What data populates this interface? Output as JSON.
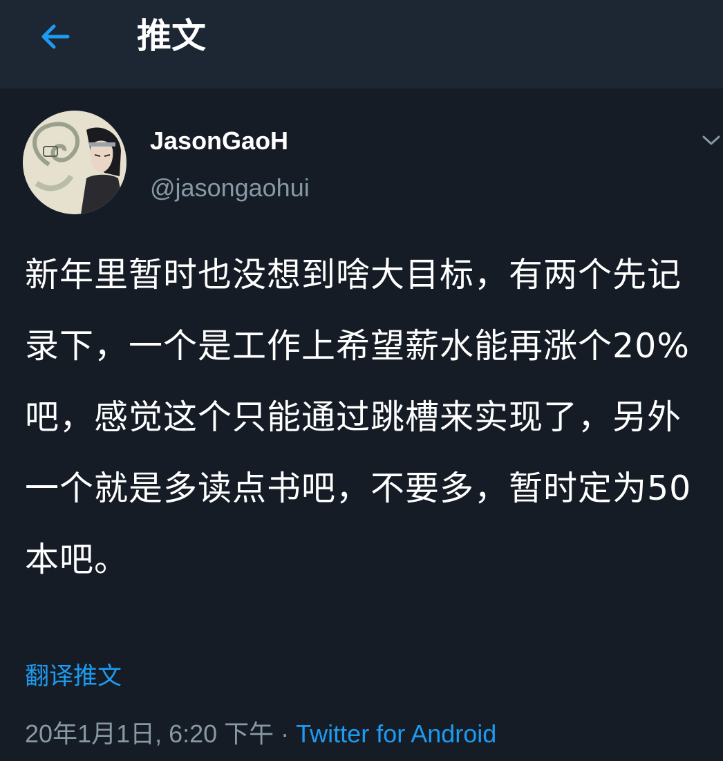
{
  "header": {
    "back_icon": "arrow-left-icon",
    "title": "推文"
  },
  "author": {
    "display_name": "JasonGaoH",
    "handle": "@jasongaohui",
    "more_icon": "chevron-down-icon"
  },
  "tweet": {
    "text": "新年里暂时也没想到啥大目标，有两个先记录下，一个是工作上希望薪水能再涨个20%吧，感觉这个只能通过跳槽来实现了，另外一个就是多读点书吧，不要多，暂时定为50本吧。",
    "translate_label": "翻译推文",
    "timestamp": "20年1月1日, 6:20 下午",
    "separator": "·",
    "source": "Twitter for Android"
  },
  "colors": {
    "background": "#151c26",
    "header_background": "#1c2733",
    "accent": "#1d9bf0",
    "secondary_text": "#8899a6"
  }
}
